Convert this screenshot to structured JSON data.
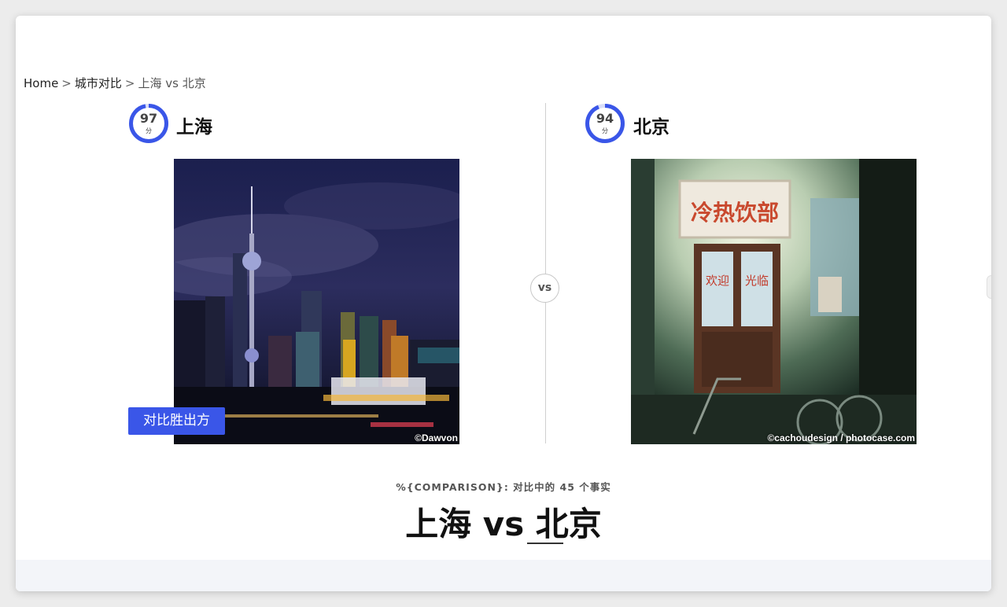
{
  "breadcrumb": {
    "home": "Home",
    "section": "城市对比",
    "current": "上海 vs 北京",
    "separator": ">"
  },
  "left": {
    "city": "上海",
    "score": "97",
    "score_fraction": 0.97,
    "score_unit": "分",
    "photo_credit": "©Dawvon",
    "winner_label": "对比胜出方"
  },
  "right": {
    "city": "北京",
    "score": "94",
    "score_fraction": 0.94,
    "score_unit": "分",
    "photo_credit": "©cachoudesign / photocase.com",
    "sign_text": "冷热饮部",
    "door_text_1": "欢迎",
    "door_text_2": "光临"
  },
  "vs_label": "vs",
  "subtitle": "%{COMPARISON}: 对比中的 45 个事实",
  "title": "上海 vs 北京",
  "colors": {
    "accent": "#3a56e8",
    "ring_track": "#d9def8"
  }
}
